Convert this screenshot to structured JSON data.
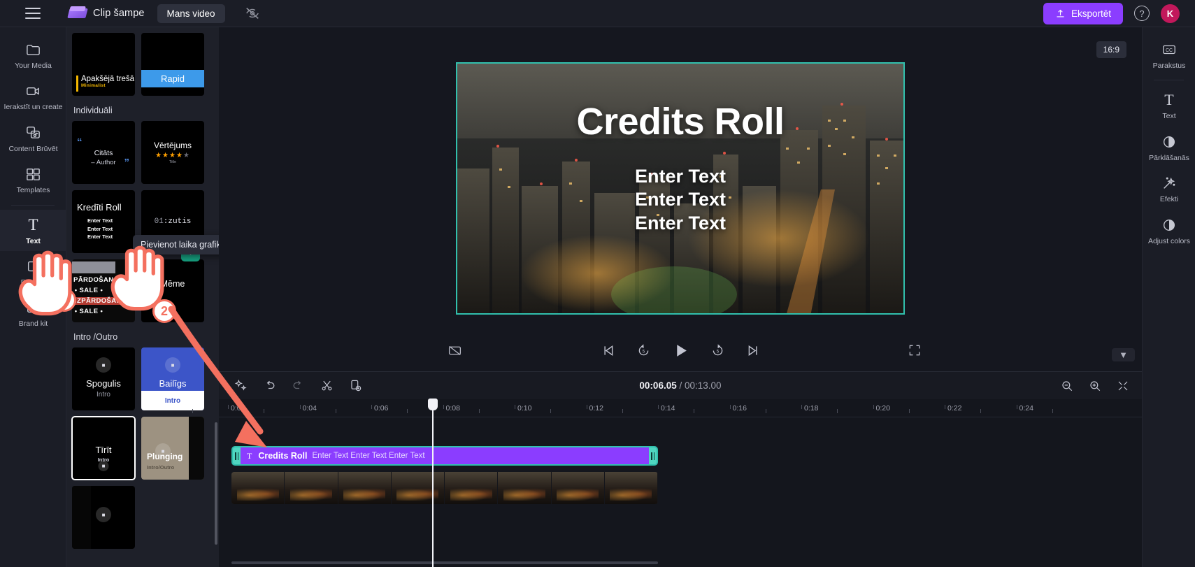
{
  "topbar": {
    "menu_icon": "hamburger-menu-icon",
    "brand": "Clip šampe",
    "project_tab": "Mans video",
    "eye_off_icon": "eye-off-icon",
    "export_label": "Eksportēt",
    "export_icon": "upload-icon",
    "export_color": "#8b3dff",
    "help_icon": "help-circle-icon",
    "avatar_initial": "K",
    "avatar_color": "#c2185b"
  },
  "left_rail": {
    "items": [
      {
        "label": "Your Media",
        "icon": "folder-icon",
        "active": false
      },
      {
        "label": "Ierakstīt un create",
        "icon": "video-camera-icon",
        "active": false
      },
      {
        "label": "Content Brūvēt",
        "icon": "content-brew-icon",
        "active": false
      },
      {
        "label": "Templates",
        "icon": "templates-grid-icon",
        "active": false
      },
      {
        "label": "Text",
        "icon": "text-t-icon",
        "active": true
      },
      {
        "label": "Pārejas",
        "icon": "transitions-icon",
        "active": false
      },
      {
        "label": "Brand kit",
        "icon": "brand-kit-icon",
        "active": false
      }
    ]
  },
  "panel": {
    "top_cards": [
      {
        "name": "Apakšējā trešā",
        "sub": "Minimalist",
        "kind": "lower-third"
      },
      {
        "name": "Rapid",
        "sub": "",
        "kind": "rapid"
      }
    ],
    "section_individual": "Individuāli",
    "individual_cards": [
      {
        "name": "Citāts",
        "author": "– Author",
        "kind": "quote"
      },
      {
        "name": "Vērtējums",
        "sub": "Title",
        "stars": "★★★★★",
        "kind": "rating"
      },
      {
        "name": "Kredīti Roll",
        "lines": "Enter Text\nEnter Text\nEnter Text",
        "kind": "credits"
      },
      {
        "name": "01",
        "suffix": ":zutis",
        "kind": "timer"
      },
      {
        "name": "PĀRDOŠANA SA",
        "lines2": "E • SALE •",
        "lines3": "IZPĀRDOŠANA",
        "lines4": "E • SALE •",
        "kind": "sale"
      },
      {
        "name": "Mēme",
        "kind": "meme"
      }
    ],
    "section_intro_outro": "Intro /Outro",
    "intro_cards": [
      {
        "name": "Spogulis",
        "kind": "Intro",
        "style": "dark"
      },
      {
        "name": "Bailīgs",
        "kind": "Intro",
        "style": "blue"
      },
      {
        "name": "Tīrīt",
        "kind": "Intro",
        "style": "selected"
      },
      {
        "name": "Plunging",
        "kind": "Intro/Outro",
        "style": "tan"
      },
      {
        "name": "",
        "kind": "",
        "style": "last"
      }
    ],
    "tooltip": "Pievienot laika grafikam",
    "add_button_icon": "plus-icon"
  },
  "stage": {
    "ratio_badge": "16:9",
    "video": {
      "title": "Credits Roll",
      "lines": [
        "Enter Text",
        "Enter Text",
        "Enter Text"
      ],
      "border_color": "#31c0ad"
    },
    "player": {
      "mute_icon": "captions-off-icon",
      "prev_icon": "skip-previous-icon",
      "back5_icon": "rewind-5-icon",
      "play_icon": "play-icon",
      "fwd5_icon": "forward-5-icon",
      "next_icon": "skip-next-icon",
      "fullscreen_icon": "fullscreen-icon"
    }
  },
  "timeline": {
    "tools": [
      {
        "icon": "magic-sparkle-icon",
        "name": "auto-enhance"
      },
      {
        "icon": "undo-icon",
        "name": "undo"
      },
      {
        "icon": "redo-icon",
        "name": "redo"
      },
      {
        "icon": "scissors-icon",
        "name": "split"
      },
      {
        "icon": "duplicate-icon",
        "name": "duplicate"
      }
    ],
    "current_time": "00:06.05",
    "separator": "/",
    "total_time": "00:13.00",
    "zoom_out_icon": "zoom-out-icon",
    "zoom_in_icon": "zoom-in-icon",
    "fit_icon": "fit-timeline-icon",
    "ruler_labels": [
      "0:02",
      "0:04",
      "0:06",
      "0:08",
      "0:10",
      "0:12",
      "0:14",
      "0:16",
      "0:18",
      "0:20",
      "0:22",
      "0:24"
    ],
    "clip_text": {
      "icon": "text-t-icon",
      "name": "Credits Roll",
      "sub": "Enter Text Enter Text Enter Text",
      "color": "#8b3dff",
      "selection_color": "#31c0ad"
    },
    "chevron_down_icon": "chevron-down-icon"
  },
  "right_rail": {
    "items": [
      {
        "label": "Parakstus",
        "icon": "closed-captions-icon"
      },
      {
        "label": "Text",
        "icon": "text-t-icon"
      },
      {
        "label": "Pārklāšanās",
        "icon": "contrast-split-icon"
      },
      {
        "label": "Efekti",
        "icon": "magic-wand-icon"
      },
      {
        "label": "Adjust colors",
        "icon": "adjust-colors-icon"
      }
    ]
  },
  "annotations": {
    "accent": "#f4705f",
    "badge_1": "1",
    "badge_2": "2",
    "cursor_1": "hand-pointer-icon",
    "cursor_2": "hand-pointer-icon",
    "arrow": "curved-arrow-icon"
  }
}
